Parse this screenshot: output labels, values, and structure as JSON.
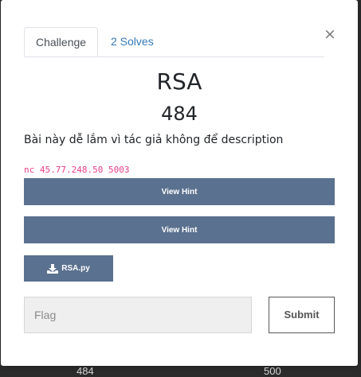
{
  "modal": {
    "close_symbol": "×",
    "tabs": [
      {
        "label": "Challenge"
      },
      {
        "label": "2 Solves"
      }
    ],
    "challenge": {
      "name": "RSA",
      "points": "484",
      "description": "Bài này dễ lắm vì tác giả không để description",
      "connection": "nc 45.77.248.50 5003",
      "hints": [
        {
          "label": "View Hint"
        },
        {
          "label": "View Hint"
        }
      ],
      "file": {
        "label": "RSA.py",
        "icon": "download-icon"
      }
    },
    "flag_input": {
      "placeholder": "Flag",
      "value": ""
    },
    "submit_label": "Submit"
  },
  "background": {
    "cards": [
      {
        "points": "484"
      },
      {
        "points": "500"
      }
    ]
  },
  "colors": {
    "accent": "#5a718f",
    "link": "#337ab7",
    "code": "#e83e8c",
    "backdrop": "#2b2b2b"
  }
}
